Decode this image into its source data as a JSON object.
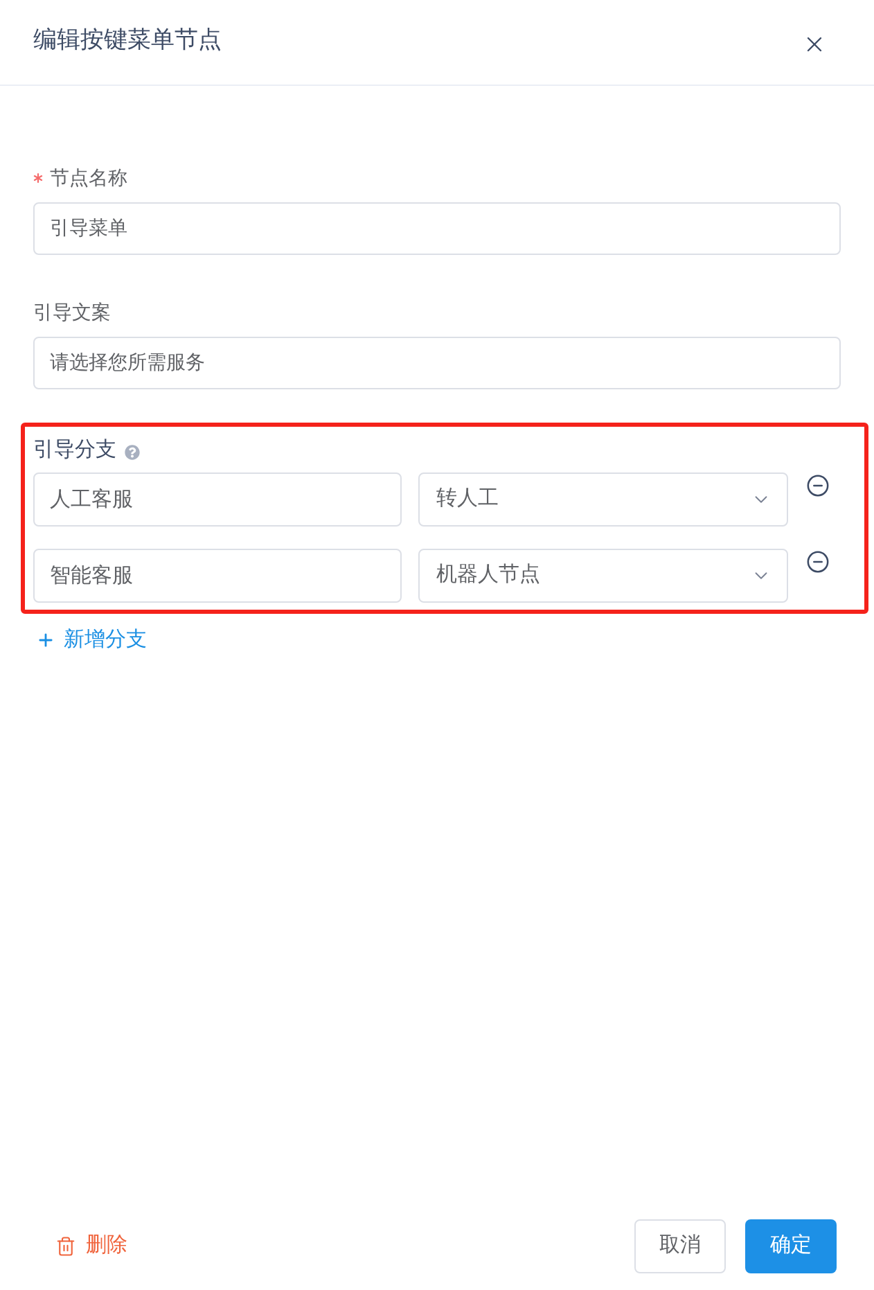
{
  "dialog": {
    "title": "编辑按键菜单节点"
  },
  "fields": [
    {
      "label": "节点名称",
      "required": true,
      "value": "引导菜单"
    },
    {
      "label": "引导文案",
      "required": false,
      "value": "请选择您所需服务"
    }
  ],
  "branches": {
    "label": "引导分支",
    "highlighted": true,
    "items": [
      {
        "name": "人工客服",
        "target": "转人工"
      },
      {
        "name": "智能客服",
        "target": "机器人节点"
      }
    ],
    "add_label": "新增分支"
  },
  "footer": {
    "delete_label": "删除",
    "cancel_label": "取消",
    "confirm_label": "确定"
  }
}
